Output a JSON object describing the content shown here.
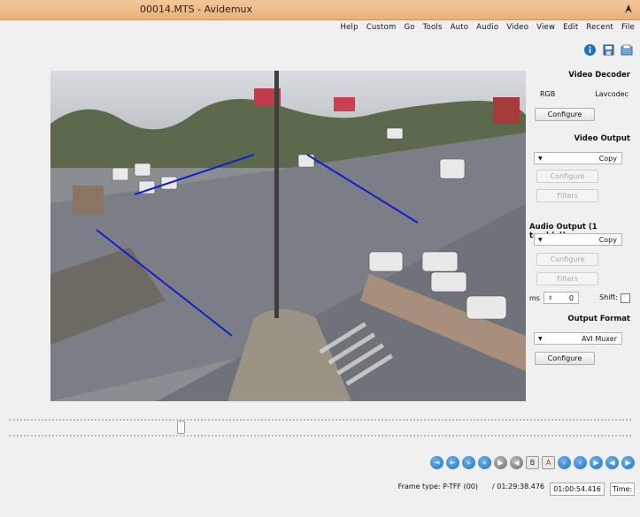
{
  "window": {
    "title": "00014.MTS - Avidemux"
  },
  "menu": [
    "File",
    "Recent",
    "Edit",
    "View",
    "Video",
    "Audio",
    "Auto",
    "Tools",
    "Go",
    "Custom",
    "Help"
  ],
  "toolbar": {
    "icons": [
      "info-icon",
      "save-icon",
      "open-icon"
    ]
  },
  "video_decoder": {
    "heading": "Video Decoder",
    "lavcodec_label": "Lavcodec",
    "rgb_label": "RGB",
    "configure": "Configure"
  },
  "video_output": {
    "heading": "Video Output",
    "selected": "Copy",
    "configure": "Configure",
    "filters": "Filters"
  },
  "audio_output": {
    "heading": "Audio Output (1 track(s))",
    "selected": "Copy",
    "configure": "Configure",
    "filters": "Filters",
    "shift_label": "Shift:",
    "shift_value": "0",
    "shift_unit": "ms"
  },
  "output_format": {
    "heading": "Output Format",
    "selected": "AVI Muxer",
    "configure": "Configure"
  },
  "playback": {
    "buttons": [
      "play",
      "rewind",
      "forward",
      "prev-frame",
      "next-frame",
      "prev-keyframe",
      "next-keyframe",
      "set-marker-a",
      "set-marker-b",
      "prev-black",
      "next-black",
      "first-frame",
      "last-frame",
      "goto-marker-a",
      "goto-marker-b"
    ]
  },
  "status": {
    "time_label": "Time:",
    "current_time": "01:00:54.416",
    "total_time": "/ 01:29:38.476",
    "frame_type": "Frame type: P-TFF (00)"
  }
}
